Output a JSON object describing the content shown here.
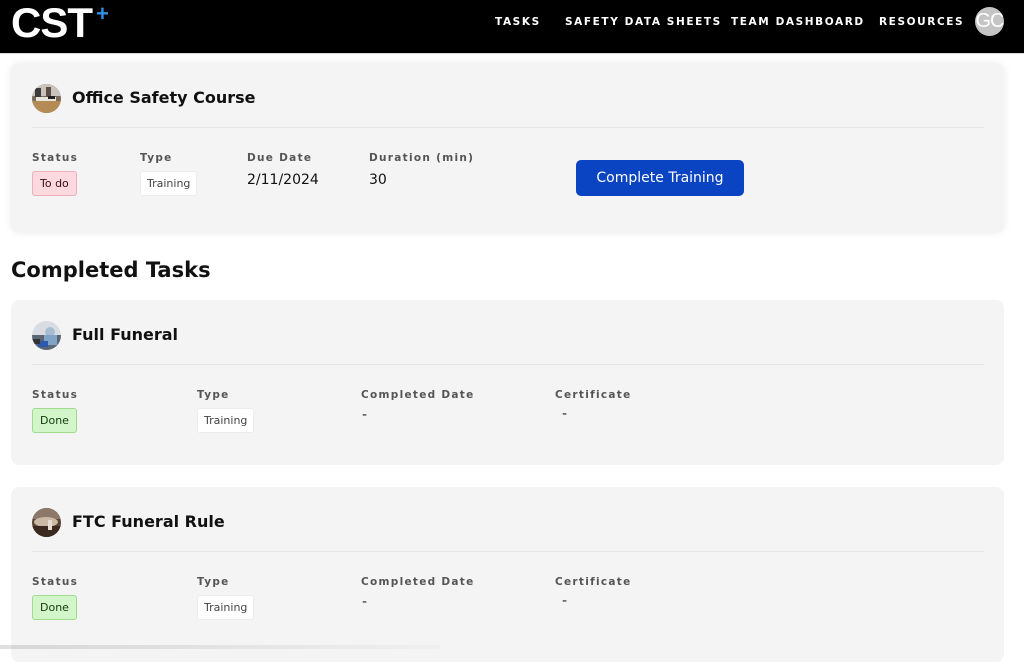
{
  "header": {
    "logo_text": "CST",
    "logo_mark": "+",
    "nav": [
      {
        "label": "TASKS"
      },
      {
        "label": "SAFETY DATA SHEETS"
      },
      {
        "label": "TEAM DASHBOARD"
      },
      {
        "label": "RESOURCES"
      }
    ],
    "avatar_initials": "GC"
  },
  "colors": {
    "accent": "#0a44c3",
    "logo_plus": "#2f8fe8",
    "todo_bg": "#fcd9df",
    "done_bg": "#d2f5c9"
  },
  "pending_task": {
    "title": "Office Safety Course",
    "thumbnail": "office-photo",
    "fields": {
      "status_label": "Status",
      "status_value": "To do",
      "type_label": "Type",
      "type_value": "Training",
      "due_label": "Due Date",
      "due_value": "2/11/2024",
      "duration_label": "Duration (min)",
      "duration_value": "30"
    },
    "action_label": "Complete Training"
  },
  "completed_section": {
    "title": "Completed Tasks",
    "tasks": [
      {
        "title": "Full Funeral",
        "thumbnail": "funeral-photo",
        "status_label": "Status",
        "status_value": "Done",
        "type_label": "Type",
        "type_value": "Training",
        "completed_label": "Completed Date",
        "completed_value": "-",
        "certificate_label": "Certificate",
        "certificate_value": "-"
      },
      {
        "title": "FTC Funeral Rule",
        "thumbnail": "ftc-photo",
        "status_label": "Status",
        "status_value": "Done",
        "type_label": "Type",
        "type_value": "Training",
        "completed_label": "Completed Date",
        "completed_value": "-",
        "certificate_label": "Certificate",
        "certificate_value": "-"
      }
    ]
  }
}
